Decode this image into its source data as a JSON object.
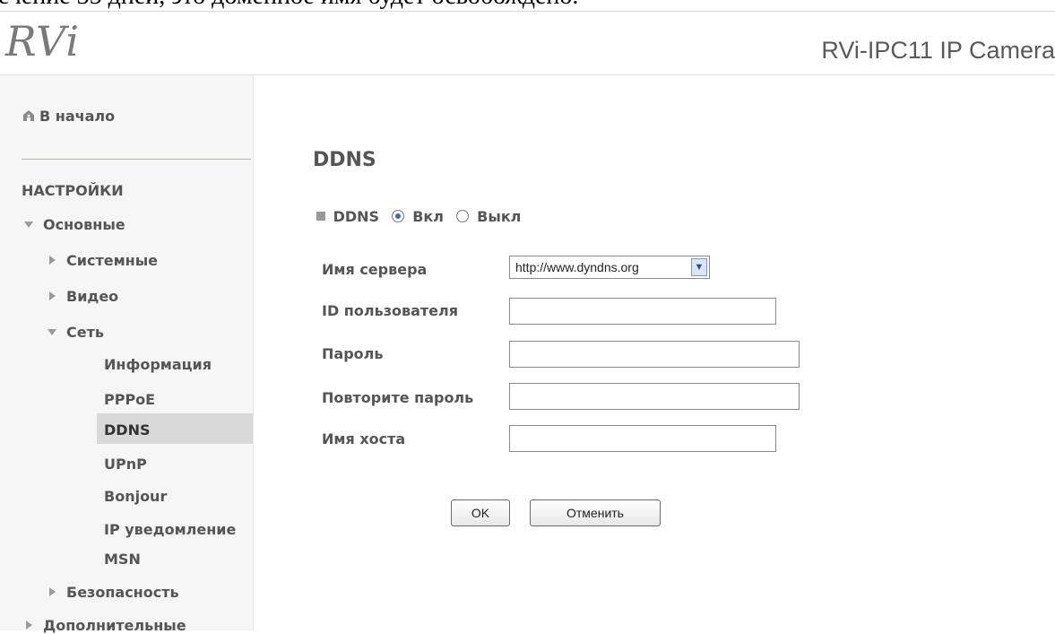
{
  "document": {
    "fragment_text": "ечение 35 дней, это доменное имя будет освобождено."
  },
  "header": {
    "logo_text": "RVi",
    "product_title": "RVi-IPC11 IP Camera"
  },
  "sidebar": {
    "home": "В начало",
    "section": "НАСТРОЙКИ",
    "items": [
      {
        "label": "Основные",
        "state": "expanded"
      },
      {
        "label": "Системные",
        "state": "collapsed"
      },
      {
        "label": "Видео",
        "state": "collapsed"
      },
      {
        "label": "Сеть",
        "state": "expanded"
      },
      {
        "label": "Безопасность",
        "state": "collapsed"
      },
      {
        "label": "Дополнительные",
        "state": "collapsed"
      }
    ],
    "network_items": [
      {
        "label": "Информация"
      },
      {
        "label": "PPPoE"
      },
      {
        "label": "DDNS",
        "active": true
      },
      {
        "label": "UPnP"
      },
      {
        "label": "Bonjour"
      },
      {
        "label": "IP уведомление"
      },
      {
        "label": "MSN"
      }
    ]
  },
  "main": {
    "title": "DDNS",
    "toggle": {
      "label": "DDNS",
      "on_label": "Вкл",
      "off_label": "Выкл",
      "selected": "on"
    },
    "fields": {
      "server_name": {
        "label": "Имя сервера",
        "value": "http://www.dyndns.org"
      },
      "user_id": {
        "label": "ID пользователя",
        "value": ""
      },
      "password": {
        "label": "Пароль",
        "value": ""
      },
      "repeat_password": {
        "label": "Повторите пароль",
        "value": ""
      },
      "host_name": {
        "label": "Имя хоста",
        "value": ""
      }
    },
    "buttons": {
      "ok": "OK",
      "cancel": "Отменить"
    }
  },
  "colors": {
    "sidebar_background": "#f6f6f6",
    "active_item_background": "#d9d9d9",
    "text": "#555555",
    "select_arrow_accent": "#2b4f8b"
  },
  "icons": {
    "home": "home-icon",
    "expanded": "arrow-down-icon",
    "collapsed": "arrow-right-icon",
    "radio_on": "radio-checked-icon",
    "radio_off": "radio-unchecked-icon",
    "select_dropdown": "chevron-down-icon"
  }
}
